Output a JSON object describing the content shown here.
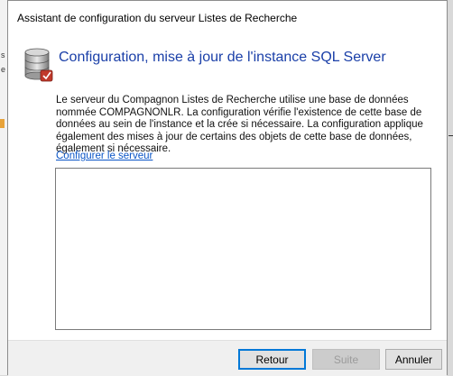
{
  "window": {
    "title": "Assistant de configuration du serveur Listes de Recherche"
  },
  "header": {
    "title": "Configuration, mise à jour de l'instance SQL Server",
    "icon": "database-server-icon"
  },
  "body": {
    "description": "Le serveur du Compagnon Listes de Recherche utilise une base de données nommée COMPAGNONLR. La configuration vérifie l'existence de cette base de données au sein de l'instance et la crée si nécessaire. La configuration applique également des mises à jour de certains des objets de cette base de données, également si nécessaire.",
    "link_label": "Configurer le serveur",
    "output_text": ""
  },
  "buttons": {
    "back_label": "Retour",
    "next_label": "Suite",
    "cancel_label": "Annuler"
  },
  "colors": {
    "header_title": "#1a3fa8",
    "link": "#0a55c7",
    "focus_border": "#0078d7"
  }
}
